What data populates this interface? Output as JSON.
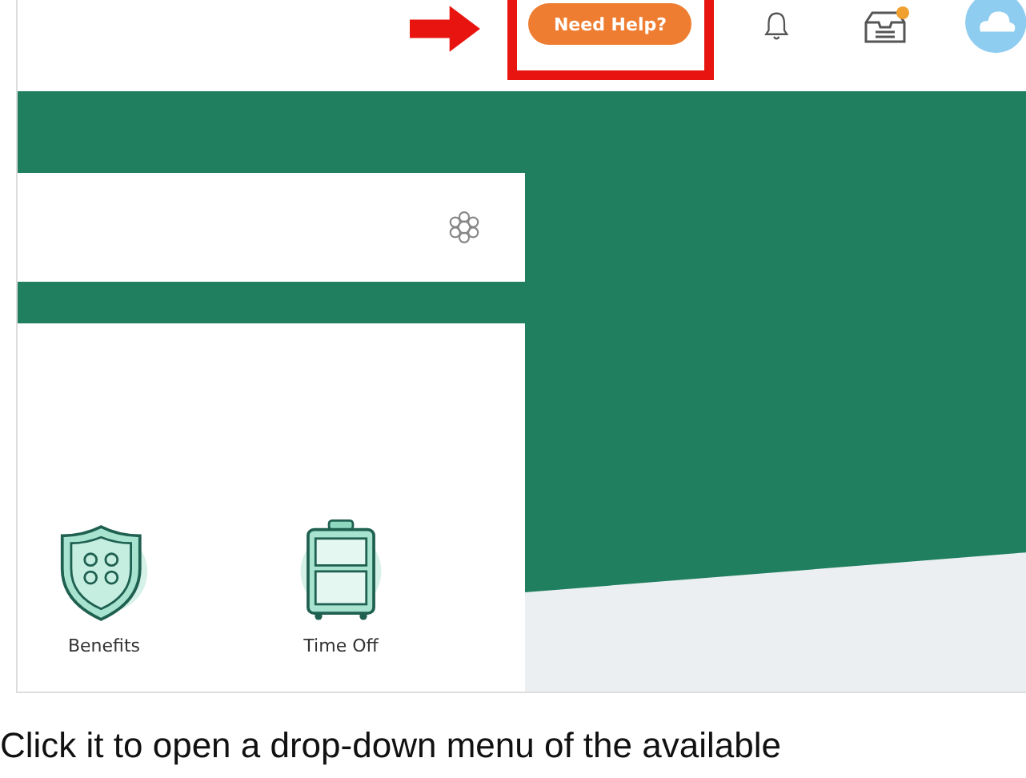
{
  "header": {
    "help_button": "Need Help?"
  },
  "apps": [
    {
      "label": "Benefits",
      "kind": "benefits"
    },
    {
      "label": "Time Off",
      "kind": "time-off"
    }
  ],
  "caption": "Click it to open a drop-down menu of the available"
}
